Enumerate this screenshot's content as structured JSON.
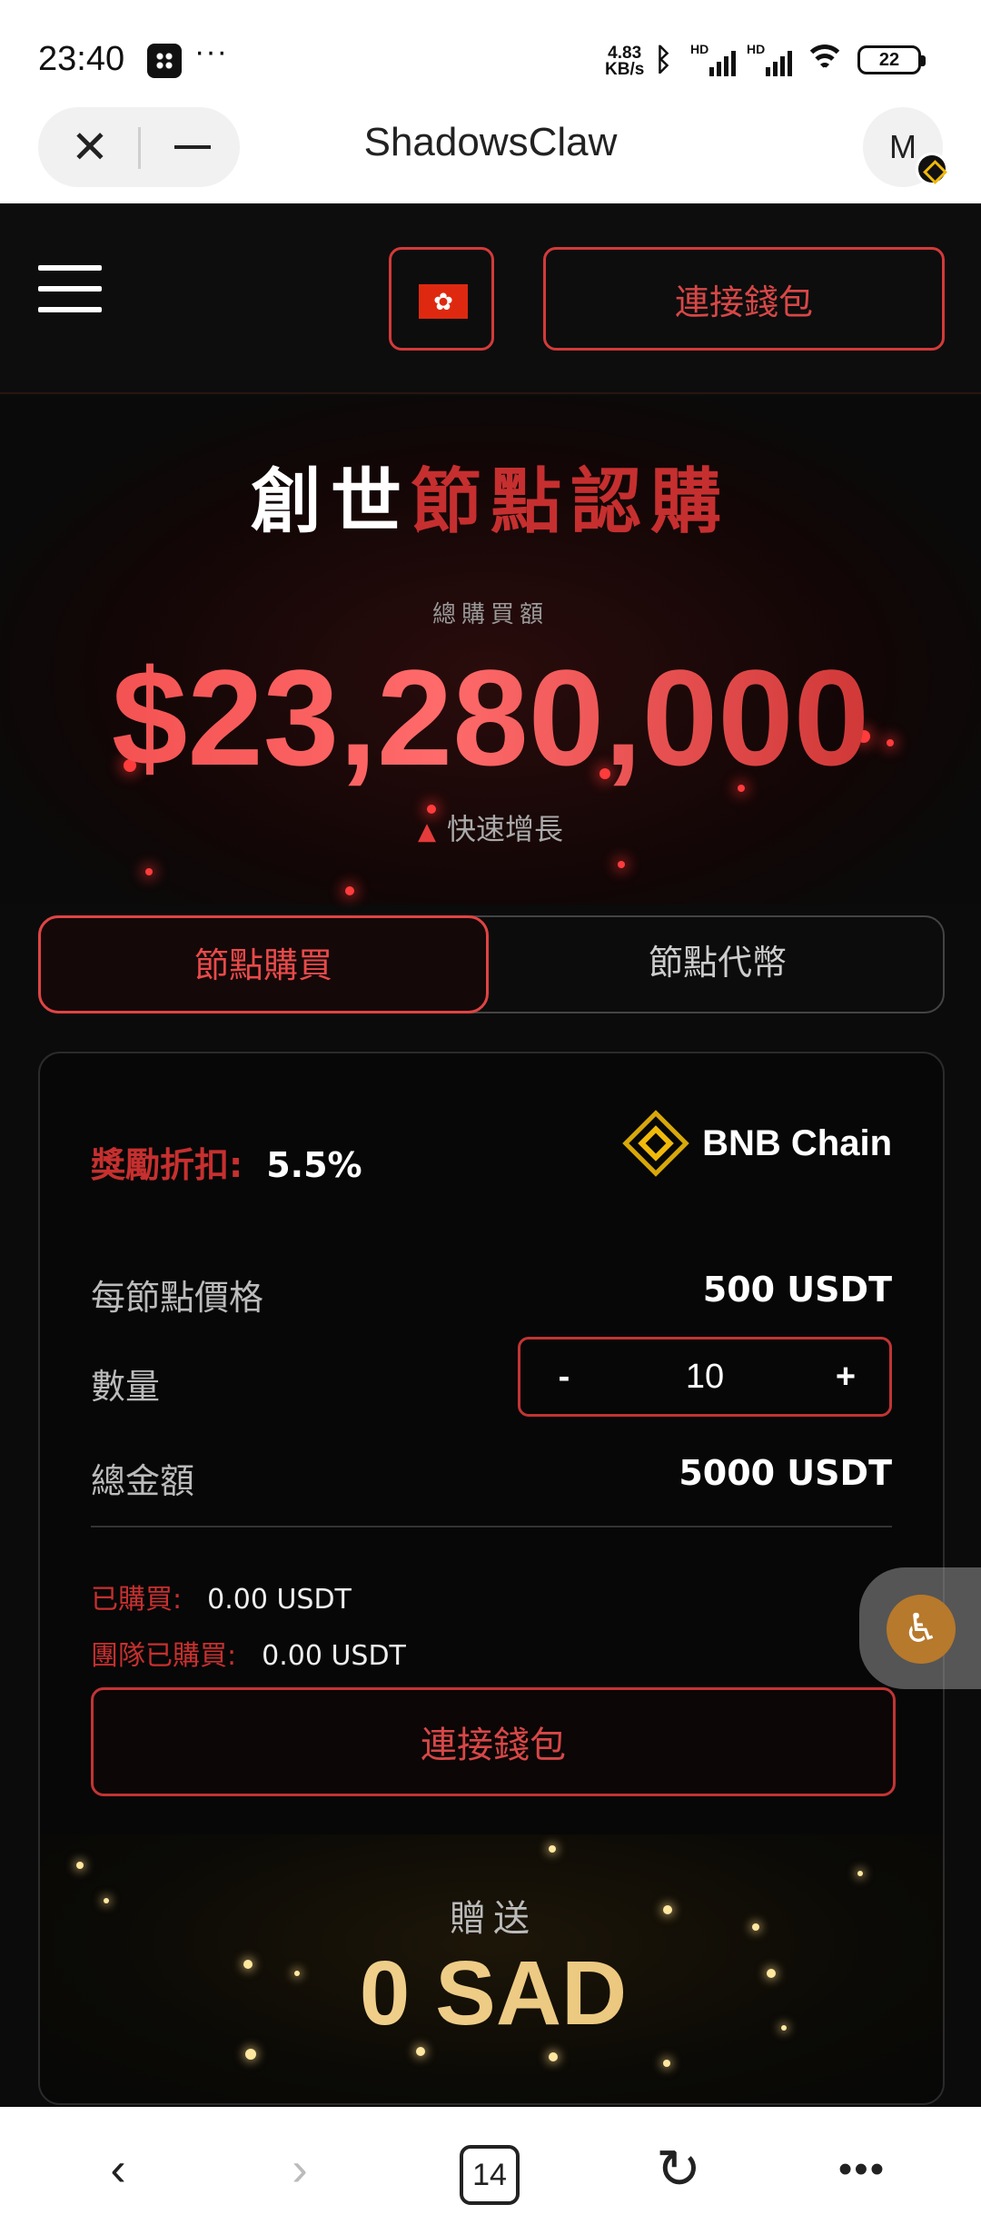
{
  "status_bar": {
    "time": "23:40",
    "more": "···",
    "net_speed_value": "4.83",
    "net_speed_unit": "KB/s",
    "hd_label": "HD",
    "battery": "22",
    "icons": [
      "app-icon",
      "bluetooth-icon",
      "signal-icon",
      "signal-icon",
      "wifi-icon",
      "battery-icon"
    ]
  },
  "browser": {
    "title": "ShadowsClaw",
    "avatar_letter": "M"
  },
  "header": {
    "connect_label": "連接錢包",
    "flag": "hong-kong-flag"
  },
  "hero": {
    "title_white": "創世",
    "title_red": "節點認購",
    "label": "總購買額",
    "amount": "$23,280,000",
    "growth_label": "快速增長"
  },
  "tabs": [
    {
      "label": "節點購買",
      "active": true
    },
    {
      "label": "節點代幣",
      "active": false
    }
  ],
  "purchase": {
    "discount_label": "獎勵折扣:",
    "discount_value": "5.5%",
    "chain_name": "BNB Chain",
    "price_label": "每節點價格",
    "price_value": "500 USDT",
    "qty_label": "數量",
    "qty_minus": "-",
    "qty_value": "10",
    "qty_plus": "+",
    "total_label": "總金額",
    "total_value": "5000 USDT",
    "bought_label": "已購買:",
    "bought_value": "0.00 USDT",
    "team_bought_label": "團隊已購買:",
    "team_bought_value": "0.00 USDT",
    "connect_label": "連接錢包",
    "gift_label": "贈送",
    "gift_amount": "0 SAD"
  },
  "bottom_nav": {
    "back": "‹",
    "forward": "›",
    "tab_count": "14",
    "reload": "↻",
    "menu": "•••"
  },
  "colors": {
    "accent_red": "#e04444",
    "gold": "#f0b90b",
    "background": "#0b0b0b"
  }
}
